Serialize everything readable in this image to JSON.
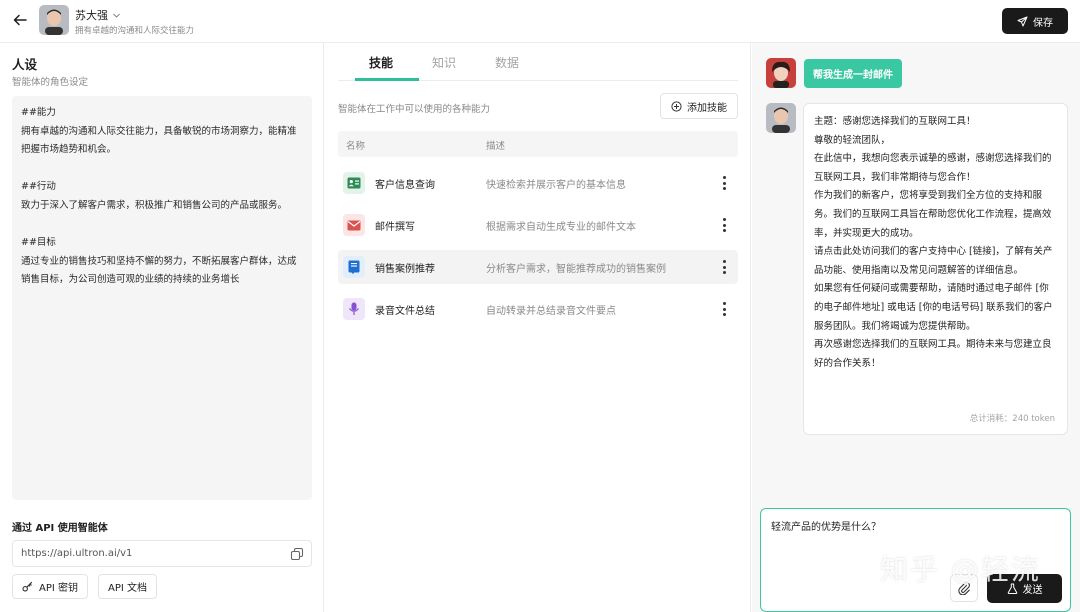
{
  "header": {
    "agent_name": "苏大强",
    "agent_desc": "拥有卓越的沟通和人际交往能力",
    "save_label": "保存"
  },
  "persona": {
    "title": "人设",
    "subtitle": "智能体的角色设定",
    "text": "##能力\n拥有卓越的沟通和人际交往能力，具备敏锐的市场洞察力，能精准把握市场趋势和机会。\n\n##行动\n致力于深入了解客户需求，积极推广和销售公司的产品或服务。\n\n##目标\n通过专业的销售技巧和坚持不懈的努力，不断拓展客户群体，达成销售目标，为公司创造可观的业绩的持续的业务增长"
  },
  "api": {
    "title": "通过 API 使用智能体",
    "url": "https://api.ultron.ai/v1",
    "key_label": "API 密钥",
    "doc_label": "API 文档"
  },
  "tabs": [
    {
      "label": "技能"
    },
    {
      "label": "知识"
    },
    {
      "label": "数据"
    }
  ],
  "skills": {
    "description": "智能体在工作中可以使用的各种能力",
    "add_label": "添加技能",
    "col_name": "名称",
    "col_desc": "描述",
    "items": [
      {
        "name": "客户信息查询",
        "desc": "快速检索并展示客户的基本信息",
        "icon": "id-card-icon",
        "color": "#2e8b57",
        "bg": "#e3f3ea"
      },
      {
        "name": "邮件撰写",
        "desc": "根据需求自动生成专业的邮件文本",
        "icon": "envelope-icon",
        "color": "#d9534f",
        "bg": "#fbe6e5"
      },
      {
        "name": "销售案例推荐",
        "desc": "分析客户需求，智能推荐成功的销售案例",
        "icon": "book-icon",
        "color": "#1f6fd1",
        "bg": "#e2eefb"
      },
      {
        "name": "录音文件总结",
        "desc": "自动转录并总结录音文件要点",
        "icon": "microphone-icon",
        "color": "#8a4fd1",
        "bg": "#efe6fa"
      }
    ]
  },
  "chat": {
    "user_message": "帮我生成一封邮件",
    "bot_message": "主题：感谢您选择我们的互联网工具！\n尊敬的轻流团队，\n在此信中，我想向您表示诚挚的感谢，感谢您选择我们的互联网工具，我们非常期待与您合作！\n作为我们的新客户，您将享受到我们全方位的支持和服务。我们的互联网工具旨在帮助您优化工作流程，提高效率，并实现更大的成功。\n请点击此处访问我们的客户支持中心 [链接]，了解有关产品功能、使用指南以及常见问题解答的详细信息。\n如果您有任何疑问或需要帮助，请随时通过电子邮件 [你的电子邮件地址] 或电话 [你的电话号码] 联系我们的客户服务团队。我们将竭诚为您提供帮助。\n再次感谢您选择我们的互联网工具。期待未来与您建立良好的合作关系！",
    "token_info": "总计消耗：240 token",
    "input_value": "轻流产品的优势是什么？",
    "send_label": "发送"
  },
  "watermark": "知乎 @轻流",
  "colors": {
    "accent": "#3ac8a2",
    "dark": "#1a1a1a"
  }
}
